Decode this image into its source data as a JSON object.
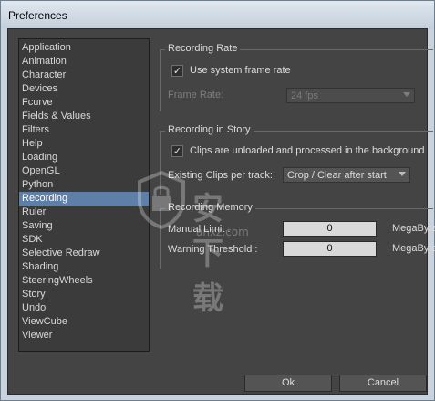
{
  "window": {
    "title": "Preferences"
  },
  "categories": [
    {
      "label": "Application",
      "selected": false
    },
    {
      "label": "Animation",
      "selected": false
    },
    {
      "label": "Character",
      "selected": false
    },
    {
      "label": "Devices",
      "selected": false
    },
    {
      "label": "Fcurve",
      "selected": false
    },
    {
      "label": "Fields & Values",
      "selected": false
    },
    {
      "label": "Filters",
      "selected": false
    },
    {
      "label": "Help",
      "selected": false
    },
    {
      "label": "Loading",
      "selected": false
    },
    {
      "label": "OpenGL",
      "selected": false
    },
    {
      "label": "Python",
      "selected": false
    },
    {
      "label": "Recording",
      "selected": true
    },
    {
      "label": "Ruler",
      "selected": false
    },
    {
      "label": "Saving",
      "selected": false
    },
    {
      "label": "SDK",
      "selected": false
    },
    {
      "label": "Selective Redraw",
      "selected": false
    },
    {
      "label": "Shading",
      "selected": false
    },
    {
      "label": "SteeringWheels",
      "selected": false
    },
    {
      "label": "Story",
      "selected": false
    },
    {
      "label": "Undo",
      "selected": false
    },
    {
      "label": "ViewCube",
      "selected": false
    },
    {
      "label": "Viewer",
      "selected": false
    }
  ],
  "recording_rate": {
    "title": "Recording Rate",
    "use_system_frame_rate": {
      "label": "Use system frame rate",
      "checked": true
    },
    "frame_rate_label": "Frame Rate:",
    "frame_rate_value": "24 fps"
  },
  "recording_in_story": {
    "title": "Recording in Story",
    "clips_unloaded": {
      "label": "Clips are unloaded and processed in the background",
      "checked": true
    },
    "existing_clips_label": "Existing Clips per track:",
    "existing_clips_value": "Crop / Clear after start"
  },
  "recording_memory": {
    "title": "Recording Memory",
    "manual_limit_label": "Manual Limit :",
    "manual_limit_value": "0",
    "manual_limit_unit": "MegaBytes",
    "warning_threshold_label": "Warning Threshold :",
    "warning_threshold_value": "0",
    "warning_threshold_unit": "MegaBytes"
  },
  "buttons": {
    "ok": "Ok",
    "cancel": "Cancel"
  },
  "watermark": {
    "text": "安下载",
    "sub": "anxz.com"
  },
  "colors": {
    "panel_bg": "#444444",
    "selected": "#5d7fa8",
    "titlebar": "#c5d0dc"
  }
}
